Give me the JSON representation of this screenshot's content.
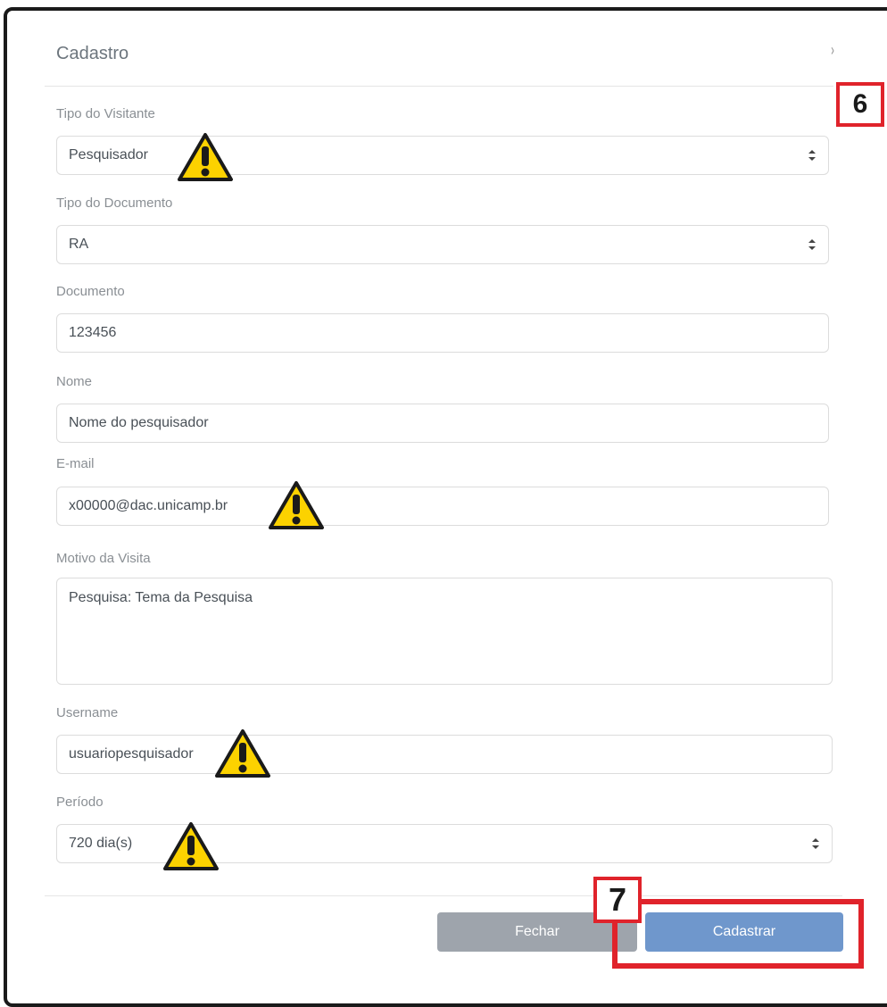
{
  "modal": {
    "title": "Cadastro",
    "close_glyph": "›"
  },
  "form": {
    "visitor_type": {
      "label": "Tipo do Visitante",
      "value": "Pesquisador"
    },
    "document_type": {
      "label": "Tipo do Documento",
      "value": "RA"
    },
    "document": {
      "label": "Documento",
      "value": "123456"
    },
    "name": {
      "label": "Nome",
      "value": "Nome do pesquisador"
    },
    "email": {
      "label": "E-mail",
      "value": "x00000@dac.unicamp.br"
    },
    "reason": {
      "label": "Motivo da Visita",
      "value": "Pesquisa: Tema da Pesquisa"
    },
    "username": {
      "label": "Username",
      "value": "usuariopesquisador"
    },
    "period": {
      "label": "Período",
      "value": "720 dia(s)"
    }
  },
  "footer": {
    "close_label": "Fechar",
    "submit_label": "Cadastrar"
  },
  "annotations": {
    "callout_6": "6",
    "callout_7": "7",
    "warning_icon": "warning-icon",
    "highlight_color": "#e0232b",
    "warning_color": "#fcd200"
  }
}
